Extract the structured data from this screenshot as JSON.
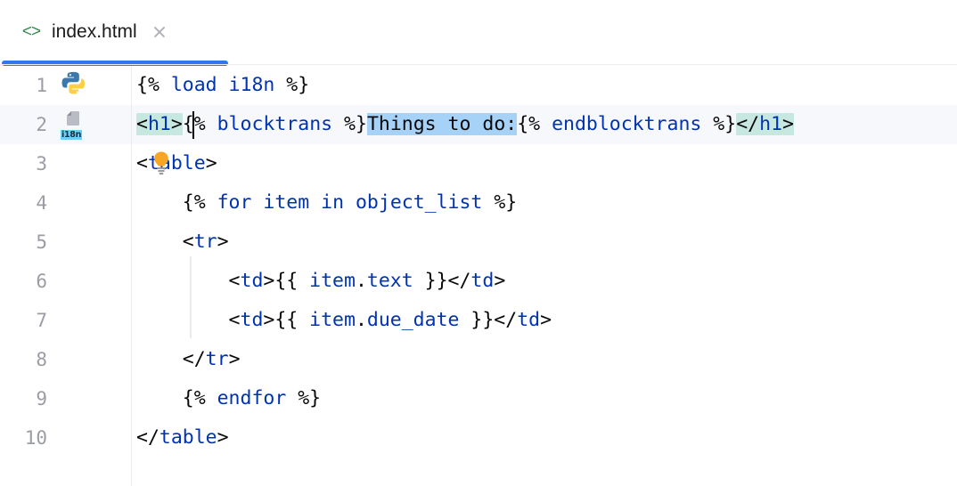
{
  "window": {
    "kind": "code-editor"
  },
  "tab": {
    "icon": "html-file-icon",
    "icon_glyph": "<>",
    "title": "index.html",
    "close_label": "×",
    "active": true,
    "accent_color": "#3574f0"
  },
  "editor": {
    "language": "HTML / Django template",
    "caret": {
      "line": 2,
      "column": 5
    },
    "selection": {
      "line": 2,
      "text": "Things to do:"
    },
    "colors": {
      "keyword": "#0033b3",
      "text": "#080808",
      "selection": "#a6d2f7",
      "matching_tag": "#c7e8e0",
      "current_line": "#f7f8fc",
      "line_number": "#9a9da6",
      "gutter_border": "#ebecf0",
      "indent_guide": "#e9e9ef"
    },
    "lines": [
      {
        "number": "1",
        "gutter_icon": "python-icon",
        "text": "{% load i18n %}",
        "tokens": [
          {
            "t": "{% ",
            "c": "plain"
          },
          {
            "t": "load i18n",
            "c": "keyword"
          },
          {
            "t": " %}",
            "c": "plain"
          }
        ]
      },
      {
        "number": "2",
        "gutter_icon": "i18n-icon",
        "gutter_icon_label": "i18n",
        "current": true,
        "text": "<h1>{% blocktrans %}Things to do:{% endblocktrans %}</h1>",
        "tokens": [
          {
            "t": "<",
            "c": "plain",
            "hl": "tag"
          },
          {
            "t": "h1",
            "c": "keyword",
            "hl": "tag"
          },
          {
            "t": ">",
            "c": "plain",
            "hl": "tag"
          },
          {
            "t": "{% ",
            "c": "plain"
          },
          {
            "t": "blocktrans",
            "c": "keyword"
          },
          {
            "t": " %}",
            "c": "plain"
          },
          {
            "t": "Things to do:",
            "c": "plain",
            "hl": "sel"
          },
          {
            "t": "{% ",
            "c": "plain"
          },
          {
            "t": "endblocktrans",
            "c": "keyword"
          },
          {
            "t": " %}",
            "c": "plain"
          },
          {
            "t": "</",
            "c": "plain",
            "hl": "tag"
          },
          {
            "t": "h1",
            "c": "keyword",
            "hl": "tag"
          },
          {
            "t": ">",
            "c": "plain",
            "hl": "tag"
          }
        ]
      },
      {
        "number": "3",
        "gutter_icon": null,
        "intention_bulb": true,
        "text": "<table>",
        "tokens": [
          {
            "t": "<",
            "c": "plain"
          },
          {
            "t": "table",
            "c": "keyword"
          },
          {
            "t": ">",
            "c": "plain"
          }
        ]
      },
      {
        "number": "4",
        "gutter_icon": null,
        "text": "    {% for item in object_list %}",
        "tokens": [
          {
            "t": "    {% ",
            "c": "plain"
          },
          {
            "t": "for",
            "c": "keyword"
          },
          {
            "t": " ",
            "c": "plain"
          },
          {
            "t": "item",
            "c": "keyword"
          },
          {
            "t": " ",
            "c": "plain"
          },
          {
            "t": "in",
            "c": "keyword"
          },
          {
            "t": " ",
            "c": "plain"
          },
          {
            "t": "object_list",
            "c": "keyword"
          },
          {
            "t": " %}",
            "c": "plain"
          }
        ]
      },
      {
        "number": "5",
        "gutter_icon": null,
        "text": "    <tr>",
        "tokens": [
          {
            "t": "    <",
            "c": "plain"
          },
          {
            "t": "tr",
            "c": "keyword"
          },
          {
            "t": ">",
            "c": "plain"
          }
        ]
      },
      {
        "number": "6",
        "gutter_icon": null,
        "text": "        <td>{{ item.text }}</td>",
        "tokens": [
          {
            "t": "        <",
            "c": "plain"
          },
          {
            "t": "td",
            "c": "keyword"
          },
          {
            "t": ">{{ ",
            "c": "plain"
          },
          {
            "t": "item",
            "c": "keyword"
          },
          {
            "t": ".",
            "c": "plain"
          },
          {
            "t": "text",
            "c": "keyword"
          },
          {
            "t": " }}</",
            "c": "plain"
          },
          {
            "t": "td",
            "c": "keyword"
          },
          {
            "t": ">",
            "c": "plain"
          }
        ]
      },
      {
        "number": "7",
        "gutter_icon": null,
        "text": "        <td>{{ item.due_date }}</td>",
        "tokens": [
          {
            "t": "        <",
            "c": "plain"
          },
          {
            "t": "td",
            "c": "keyword"
          },
          {
            "t": ">{{ ",
            "c": "plain"
          },
          {
            "t": "item",
            "c": "keyword"
          },
          {
            "t": ".",
            "c": "plain"
          },
          {
            "t": "due_date",
            "c": "keyword"
          },
          {
            "t": " }}</",
            "c": "plain"
          },
          {
            "t": "td",
            "c": "keyword"
          },
          {
            "t": ">",
            "c": "plain"
          }
        ]
      },
      {
        "number": "8",
        "gutter_icon": null,
        "text": "    </tr>",
        "tokens": [
          {
            "t": "    </",
            "c": "plain"
          },
          {
            "t": "tr",
            "c": "keyword"
          },
          {
            "t": ">",
            "c": "plain"
          }
        ]
      },
      {
        "number": "9",
        "gutter_icon": null,
        "text": "    {% endfor %}",
        "tokens": [
          {
            "t": "    {% ",
            "c": "plain"
          },
          {
            "t": "endfor",
            "c": "keyword"
          },
          {
            "t": " %}",
            "c": "plain"
          }
        ]
      },
      {
        "number": "10",
        "gutter_icon": null,
        "text": "</table>",
        "tokens": [
          {
            "t": "</",
            "c": "plain"
          },
          {
            "t": "table",
            "c": "keyword"
          },
          {
            "t": ">",
            "c": "plain"
          }
        ]
      }
    ]
  }
}
